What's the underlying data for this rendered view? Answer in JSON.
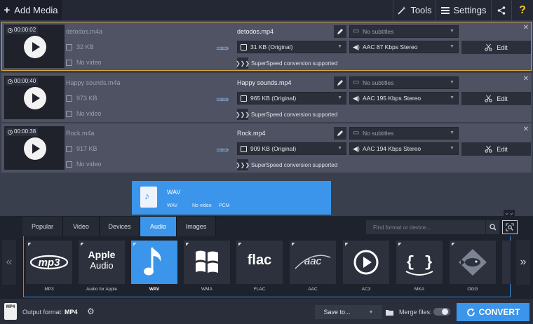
{
  "topbar": {
    "add_media": "Add Media",
    "tools": "Tools",
    "settings": "Settings",
    "help": "?"
  },
  "files": [
    {
      "time": "00:00:02",
      "source_name": "detodos.m4a",
      "source_size": "32 KB",
      "source_video": "No video",
      "output_name": "detodos.mp4",
      "output_size": "31 KB (Original)",
      "subtitles": "No subtitles",
      "audio": "AAC 87 Kbps Stereo",
      "edit": "Edit",
      "superspeed": "SuperSpeed conversion supported",
      "selected": true
    },
    {
      "time": "00:00:40",
      "source_name": "Happy sounds.m4a",
      "source_size": "973 KB",
      "source_video": "No video",
      "output_name": "Happy sounds.mp4",
      "output_size": "965 KB (Original)",
      "subtitles": "No subtitles",
      "audio": "AAC 195 Kbps Stereo",
      "edit": "Edit",
      "superspeed": "SuperSpeed conversion supported",
      "selected": false
    },
    {
      "time": "00:00:38",
      "source_name": "Rock.m4a",
      "source_size": "917 KB",
      "source_video": "No video",
      "output_name": "Rock.mp4",
      "output_size": "909 KB (Original)",
      "subtitles": "No subtitles",
      "audio": "AAC 194 Kbps Stereo",
      "edit": "Edit",
      "superspeed": "SuperSpeed conversion supported",
      "selected": false
    }
  ],
  "format_popup": {
    "title": "WAV",
    "codec": "WAV",
    "video": "No video",
    "audio": "PCM"
  },
  "format_tabs": [
    "Popular",
    "Video",
    "Devices",
    "Audio",
    "Images"
  ],
  "active_tab": "Audio",
  "search_placeholder": "Find format or device...",
  "formats": [
    {
      "label": "MP3",
      "icon": "mp3-logo-icon"
    },
    {
      "label": "Audio for Apple",
      "icon": "apple-audio-icon",
      "logo_line1": "Apple",
      "logo_line2": "Audio"
    },
    {
      "label": "WAV",
      "icon": "music-note-icon"
    },
    {
      "label": "WMA",
      "icon": "windows-logo-icon"
    },
    {
      "label": "FLAC",
      "icon": "flac-logo-icon",
      "logo_text": "flac"
    },
    {
      "label": "AAC",
      "icon": "aac-logo-icon",
      "logo_text": "aac"
    },
    {
      "label": "AC3",
      "icon": "ac3-play-icon"
    },
    {
      "label": "MKA",
      "icon": "mka-braces-icon"
    },
    {
      "label": "OGG",
      "icon": "ogg-fish-icon"
    }
  ],
  "selected_format": "WAV",
  "footer": {
    "output_label": "Output format:",
    "output_value": "MP4",
    "save_to": "Save to...",
    "merge_files": "Merge files:",
    "convert": "CONVERT"
  },
  "colors": {
    "accent": "#3b95ea",
    "selected_border": "#d7a640"
  }
}
